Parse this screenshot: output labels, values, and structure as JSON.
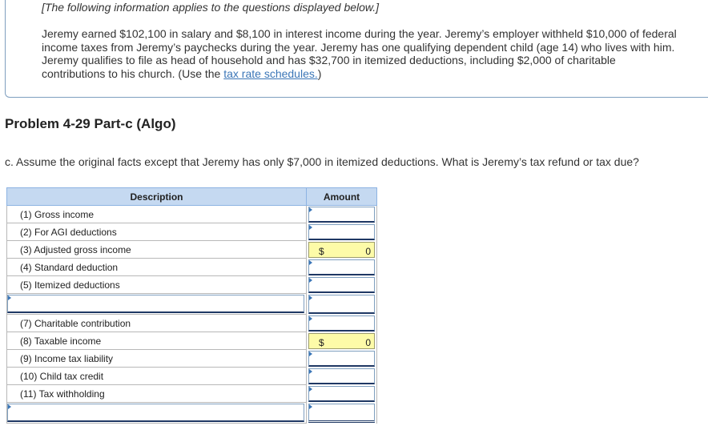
{
  "info": {
    "heading": "[The following information applies to the questions displayed below.]",
    "text_before_link": "Jeremy earned $102,100 in salary and $8,100 in interest income during the year. Jeremy’s employer withheld $10,000 of federal income taxes from Jeremy’s paychecks during the year. Jeremy has one qualifying dependent child (age 14) who lives with him. Jeremy qualifies to file as head of household and has $32,700 in itemized deductions, including $2,000 of charitable contributions to his church. (Use the ",
    "link_text": "tax rate schedules.",
    "text_after_link": ")"
  },
  "problem_title": "Problem 4-29 Part-c (Algo)",
  "question": "c. Assume the original facts except that Jeremy has only $7,000 in itemized deductions. What is Jeremy’s tax refund or tax due?",
  "table": {
    "headers": {
      "description": "Description",
      "amount": "Amount"
    },
    "rows": [
      {
        "label": "(1) Gross income",
        "dollar": "",
        "value": "",
        "computed": false
      },
      {
        "label": "(2) For AGI deductions",
        "dollar": "",
        "value": "",
        "computed": false
      },
      {
        "label": "(3) Adjusted gross income",
        "dollar": "$",
        "value": "0",
        "computed": true
      },
      {
        "label": "(4) Standard deduction",
        "dollar": "",
        "value": "",
        "computed": false
      },
      {
        "label": "(5) Itemized deductions",
        "dollar": "",
        "value": "",
        "computed": false
      },
      {
        "label": "",
        "dollar": "",
        "value": "",
        "computed": false
      },
      {
        "label": "(7) Charitable contribution",
        "dollar": "",
        "value": "",
        "computed": false
      },
      {
        "label": "(8) Taxable income",
        "dollar": "$",
        "value": "0",
        "computed": true
      },
      {
        "label": "(9) Income tax liability",
        "dollar": "",
        "value": "",
        "computed": false
      },
      {
        "label": "(10) Child tax credit",
        "dollar": "",
        "value": "",
        "computed": false
      },
      {
        "label": "(11) Tax withholding",
        "dollar": "",
        "value": "",
        "computed": false
      },
      {
        "label": "",
        "dollar": "",
        "value": "",
        "computed": false
      }
    ]
  }
}
